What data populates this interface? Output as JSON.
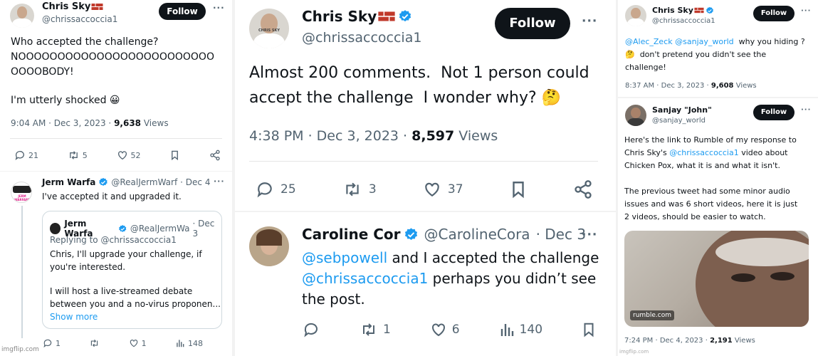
{
  "p1": {
    "author": "Chris Sky",
    "handle": "@chrissaccoccia1",
    "follow": "Follow",
    "text_1": "Who accepted the challenge?",
    "text_2": "NOOOOOOOOOOOOOOOOOOOOOOOOO",
    "text_3": "OOOOBODY!",
    "text_4": "I'm utterly shocked 😀",
    "time": "9:04 AM · Dec 3, 2023 · ",
    "views": "9,638",
    "views_label": " Views",
    "replies": "21",
    "reposts": "5",
    "likes": "52"
  },
  "p1b": {
    "author": "Jerm Warfa",
    "handle": "@RealJermWarf",
    "date": "· Dec 4",
    "text": "I've accepted it and upgraded it.",
    "avatar_text": "JERM WARFARE",
    "quote": {
      "author": "Jerm Warfa",
      "handle": "@RealJermWa",
      "date": "· Dec 3",
      "replying_prefix": "Replying to ",
      "replying_handle": "@chrissaccoccia1",
      "line_1": "Chris, I'll upgrade your challenge, if",
      "line_2": "you're interested.",
      "line_3": "I will host a live-streamed debate",
      "line_4": "between you and a no-virus proponen...",
      "show_more": "Show more"
    },
    "replies": "1",
    "likes": "1",
    "views": "148",
    "watermark": "imgflip.com"
  },
  "p2": {
    "author": "Chris Sky",
    "handle": "@chrissaccoccia1",
    "follow": "Follow",
    "avatar_text": "CHRIS SKY",
    "text_1": "Almost 200 comments.  Not 1 person could",
    "text_2": "accept the challenge  I wonder why? 🤔",
    "time": "4:38 PM · Dec 3, 2023 · ",
    "views": "8,597",
    "views_label": " Views",
    "replies": "25",
    "reposts": "3",
    "likes": "37"
  },
  "p2b": {
    "author": "Caroline Cor",
    "handle": "@CarolineCora",
    "date": "· Dec 3",
    "mention_1": "@sebpowell",
    "text_1": " and I accepted the challenge",
    "mention_2": "@chrissaccoccia1",
    "text_2": " perhaps you didn’t see",
    "text_3": "the post.",
    "reposts": "1",
    "likes": "6",
    "views": "140"
  },
  "p3": {
    "author": "Chris Sky",
    "handle": "@chrissaccoccia1",
    "follow": "Follow",
    "mention_1": "@Alec_Zeck",
    "mention_2": "@sanjay_world",
    "text_1": "  why you hiding ?",
    "text_2": "🤔  don't pretend you didn't see the",
    "text_3": "challenge!",
    "time": "8:37 AM · Dec 3, 2023 · ",
    "views": "9,608",
    "views_label": " Views"
  },
  "p3b": {
    "author": "Sanjay \"John\"",
    "handle": "@sanjay_world",
    "follow": "Follow",
    "text_1": "Here's the link to Rumble of my response to",
    "text_2a": "Chris Sky's ",
    "text_2m": "@chrissaccoccia1",
    "text_2b": " video about",
    "text_3": "Chicken Pox, what it is and what it isn't.",
    "text_4": "The previous tweet had some minor audio",
    "text_5": "issues and was 6 short videos, here it is just",
    "text_6": "2 videos, should be easier to watch.",
    "card_domain": "rumble.com",
    "time": "7:24 PM · Dec 4, 2023 · ",
    "views": "2,191",
    "views_label": " Views",
    "watermark": "imgflip.com"
  },
  "colors": {
    "accent": "#1d9bf0",
    "text": "#0f1419",
    "muted": "#536471"
  }
}
